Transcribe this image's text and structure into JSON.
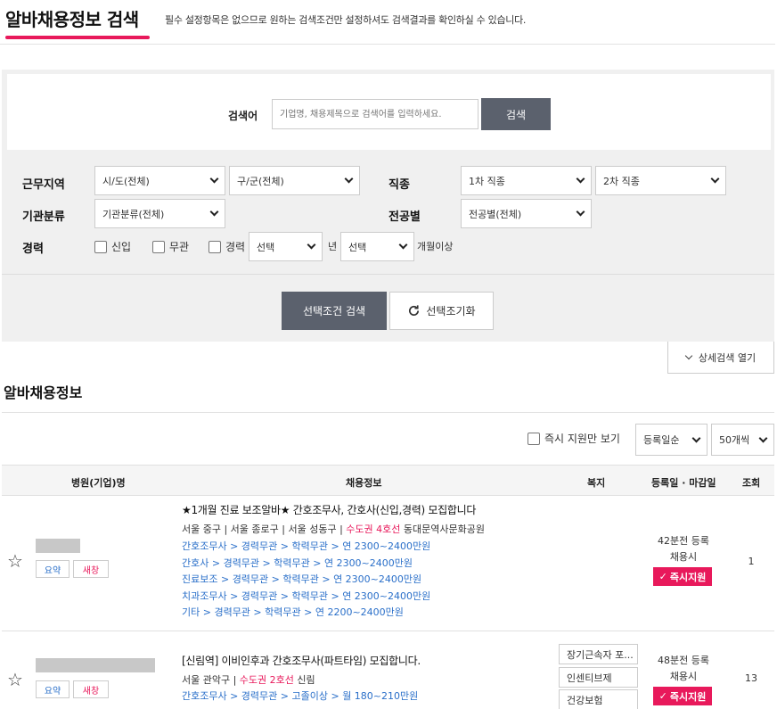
{
  "header": {
    "title": "알바채용정보 검색",
    "description": "필수 설정항목은 없으므로 원하는 검색조건만 설정하셔도 검색결과를 확인하실 수 있습니다."
  },
  "search": {
    "keyword_label": "검색어",
    "keyword_placeholder": "기업명, 채용제목으로 검색어를 입력하세요.",
    "keyword_button": "검색"
  },
  "filters": {
    "region_label": "근무지역",
    "region_sido": "시/도(전체)",
    "region_gugun": "구/군(전체)",
    "job_label": "직종",
    "job_first": "1차 직종",
    "job_second": "2차 직종",
    "org_label": "기관분류",
    "org_value": "기관분류(전체)",
    "major_label": "전공별",
    "major_value": "전공별(전체)",
    "career_label": "경력",
    "career_new": "신입",
    "career_none": "무관",
    "career_exp": "경력",
    "career_year_select": "선택",
    "career_year_unit": "년",
    "career_month_select": "선택",
    "career_month_unit": "개월이상"
  },
  "buttons": {
    "search_selected": "선택조건 검색",
    "reset": "선택조기화",
    "advanced": "상세검색 열기"
  },
  "listing": {
    "section_title": "알바채용정보",
    "instant_only": "즉시 지원만 보기",
    "sort": "등록일순",
    "per_page": "50개씩",
    "columns": [
      "병원(기업)명",
      "채용정보",
      "복지",
      "등록일 · 마감일",
      "조회"
    ]
  },
  "rows": [
    {
      "summary": "요약",
      "new_window": "새창",
      "title": "★1개월 진료 보조알바★ 간호조무사, 간호사(신입,경력) 모집합니다",
      "location_prefix": "서울 중구 | 서울 종로구 | 서울 성동구 | ",
      "subway": "수도권 4호선",
      "location_suffix": " 동대문역사문화공원",
      "positions": [
        "간호조무사 > 경력무관 > 학력무관 > 연 2300~2400만원",
        "간호사 > 경력무관 > 학력무관 > 연 2300~2400만원",
        "진료보조 > 경력무관 > 학력무관 > 연 2300~2400만원",
        "치과조무사 > 경력무관 > 학력무관 > 연 2300~2400만원",
        "기타 > 경력무관 > 학력무관 > 연 2200~2400만원"
      ],
      "welfare": [],
      "registered": "42분전 등록",
      "deadline": "채용시",
      "apply": "즉시지원",
      "views": "1"
    },
    {
      "summary": "요약",
      "new_window": "새창",
      "title": "[신림역] 이비인후과 간호조무사(파트타임) 모집합니다.",
      "location_prefix": "서울 관악구 | ",
      "subway": "수도권 2호선",
      "location_suffix": " 신림",
      "positions": [
        "간호조무사 > 경력무관 > 고졸이상 > 월 180~210만원"
      ],
      "welfare": [
        "장기근속자 포...",
        "인센티브제",
        "건강보험"
      ],
      "registered": "48분전 등록",
      "deadline": "채용시",
      "apply": "즉시지원",
      "views": "13"
    }
  ],
  "colors": {
    "accent": "#e8195b",
    "button_dark": "#5b616d",
    "link_blue": "#2a6fc9"
  }
}
